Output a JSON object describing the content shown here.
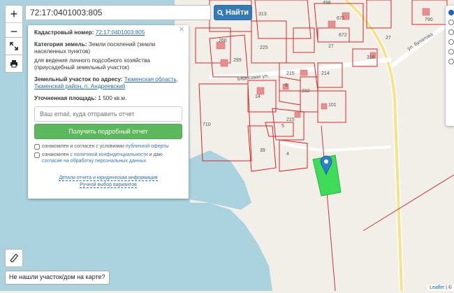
{
  "search": {
    "value": "72:17:0401003:805",
    "button_label": "Найти"
  },
  "zoom": {
    "in_label": "+",
    "out_label": "−"
  },
  "panel": {
    "close_label": "×",
    "cadastral_label": "Кадастровый номер:",
    "cadastral_value": "72:17:0401003:805",
    "category_label": "Категория земель:",
    "category_value": "Земли поселений (земли населенных пунктов)",
    "use_value": "для ведения личного подсобного хозяйства (приусадебный земельный участок)",
    "address_label": "Земельный участок по адресу:",
    "address_value": "Тюменская область, Тюменский район, п. Андреевский",
    "area_label": "Уточненная площадь:",
    "area_value": "1 500 кв.м.",
    "email_placeholder": "Ваш email, куда отправить отчет",
    "report_button": "Получить подробный отчет",
    "check1_text": "ознакомлен и согласен с условиями",
    "check1_link": "публичной оферты",
    "check2_text": "ознакомлен с",
    "check2_link1": "политикой конфиденциальности",
    "check2_mid": "и даю",
    "check2_link2": "согласие на обработку персональных данных",
    "details_link": "Детали отчета и юридическая информация",
    "manual_link": "Ручной выбор вариантов"
  },
  "not_found_button": "Не нашли участок/дом на карте?",
  "attribution": {
    "leaflet": "Leaflet",
    "rest": "| ©"
  },
  "map_labels": {
    "plots": [
      "313",
      "498",
      "671",
      "790",
      "260",
      "299",
      "225",
      "672",
      "27",
      "316",
      "27",
      "215",
      "214",
      "6",
      "14",
      "232",
      "101",
      "710",
      "5",
      "215",
      "4",
      "39"
    ],
    "streets": [
      "Береговая ул.",
      "ул. Булатова"
    ]
  },
  "colors": {
    "water": "#aad3df",
    "land": "#f2efe9",
    "parcel_line": "#d9262b",
    "selected_parcel": "#3fdc5a",
    "marker": "#2a81cb"
  },
  "icons": {
    "fullscreen": "expand-icon",
    "print": "print-icon",
    "ruler": "ruler-icon",
    "search": "search-icon",
    "marker": "map-marker-icon"
  }
}
